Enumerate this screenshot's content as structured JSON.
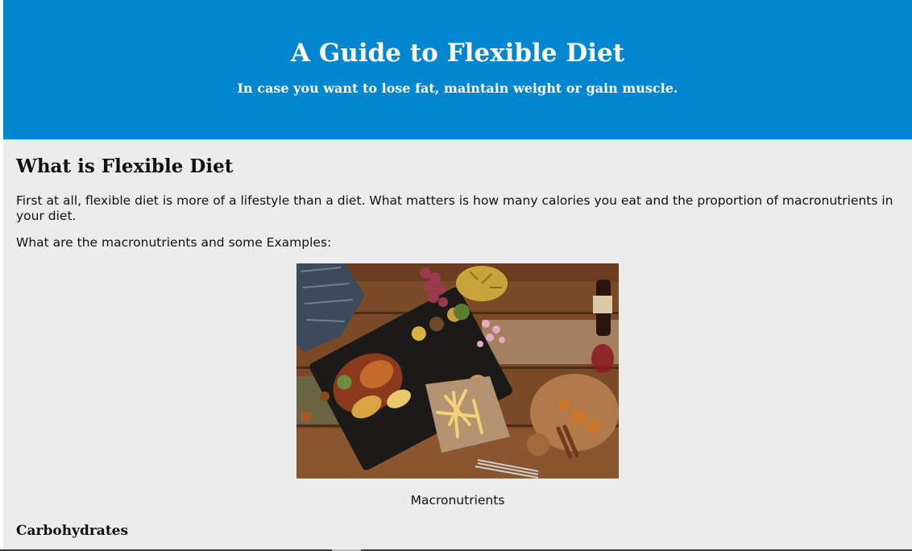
{
  "header": {
    "title": "A Guide to Flexible Diet",
    "subtitle": "In case you want to lose fat, maintain weight or gain muscle."
  },
  "section": {
    "heading": "What is Flexible Diet",
    "intro": "First at all, flexible diet is more of a lifestyle than a diet. What matters is how many calories you eat and the proportion of macronutrients in your diet.",
    "examples_lead": "What are the macronutrients and some Examples:"
  },
  "figure": {
    "caption": "Macronutrients"
  },
  "next_heading": "Carbohydrates"
}
